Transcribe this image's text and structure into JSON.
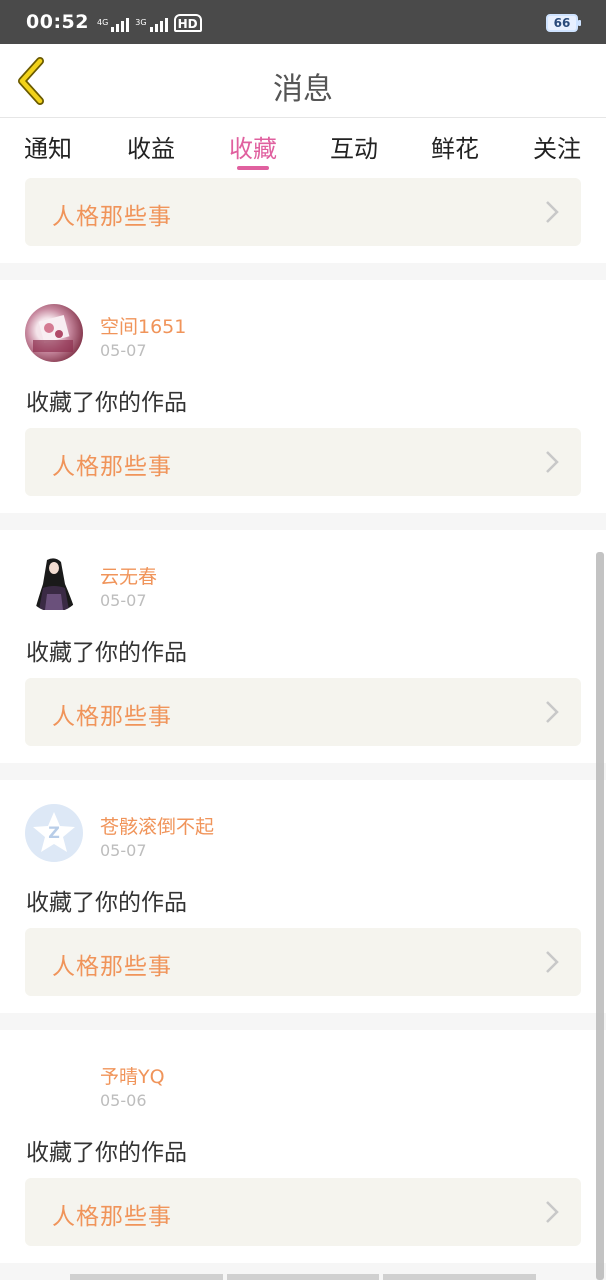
{
  "status_bar": {
    "time": "00:52",
    "signal_1_label": "4G",
    "signal_2_label": "3G",
    "hd_label": "HD",
    "battery": "66"
  },
  "header": {
    "title": "消息",
    "back_icon": "chevron-left-icon"
  },
  "tabs": [
    {
      "label": "通知",
      "active": false
    },
    {
      "label": "收益",
      "active": false
    },
    {
      "label": "收藏",
      "active": true
    },
    {
      "label": "互动",
      "active": false
    },
    {
      "label": "鲜花",
      "active": false
    },
    {
      "label": "关注",
      "active": false
    }
  ],
  "colors": {
    "accent": "#e0609f",
    "name_orange": "#f0945a",
    "card_bg": "#f5f4ee"
  },
  "feed": {
    "top_card": {
      "work_title": "人格那些事"
    },
    "items": [
      {
        "user": "空间1651",
        "date": "05-07",
        "action": "收藏了你的作品",
        "work_title": "人格那些事",
        "avatar": "anime-illustration"
      },
      {
        "user": "云无春",
        "date": "05-07",
        "action": "收藏了你的作品",
        "work_title": "人格那些事",
        "avatar": "dark-haired-character"
      },
      {
        "user": "苍骸滚倒不起",
        "date": "05-07",
        "action": "收藏了你的作品",
        "work_title": "人格那些事",
        "avatar": "default-z-icon"
      },
      {
        "user": "予晴YQ",
        "date": "05-06",
        "action": "收藏了你的作品",
        "work_title": "人格那些事",
        "avatar": "blank"
      }
    ]
  }
}
